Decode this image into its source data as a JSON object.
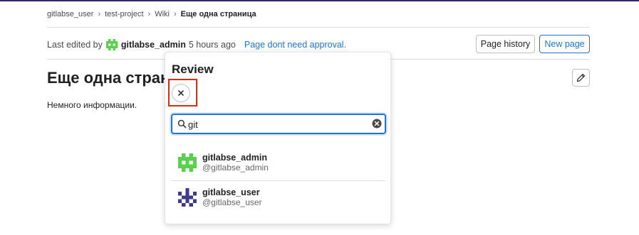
{
  "colors": {
    "accent": "#1f75cb",
    "highlight": "#dd2b0e",
    "admin_avatar": "#5bd04f",
    "user_avatar": "#3d3a8f"
  },
  "breadcrumb": {
    "items": [
      "gitlabse_user",
      "test-project",
      "Wiki"
    ],
    "current": "Еще одна страница",
    "separator": "›"
  },
  "last_edited": {
    "prefix": "Last edited by",
    "author": "gitlabse_admin",
    "time": "5 hours ago",
    "approval_text": "Page dont need approval."
  },
  "buttons": {
    "page_history": "Page history",
    "new_page": "New page",
    "edit_icon": "pencil-icon"
  },
  "page": {
    "title": "Еще одна стран",
    "body": "Немного информации."
  },
  "review_popover": {
    "title": "Review",
    "close_icon": "close-icon",
    "search": {
      "value": "git",
      "search_icon": "search-icon",
      "clear_icon": "clear-icon"
    },
    "users": [
      {
        "name": "gitlabse_admin",
        "handle": "@gitlabse_admin",
        "avatar_icon": "identicon-green"
      },
      {
        "name": "gitlabse_user",
        "handle": "@gitlabse_user",
        "avatar_icon": "identicon-purple"
      }
    ]
  }
}
